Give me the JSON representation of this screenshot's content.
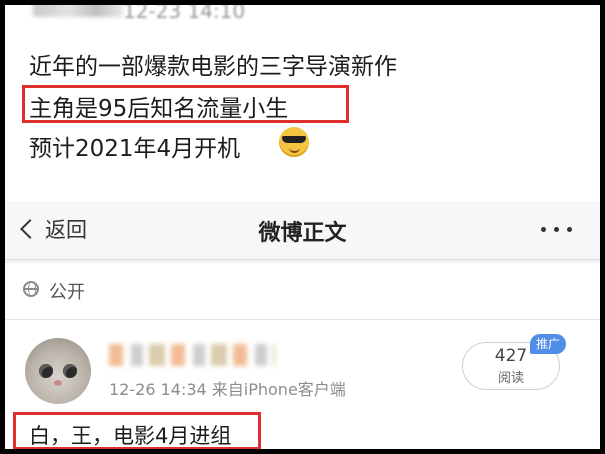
{
  "top_post": {
    "timestamp": "12-23 14:10",
    "lines": [
      "近年的一部爆款电影的三字导演新作",
      "主角是95后知名流量小生",
      "预计2021年4月开机"
    ],
    "emoji_icon": "sunglasses-emoji-icon"
  },
  "nav": {
    "back_label": "返回",
    "title": "微博正文"
  },
  "visibility": {
    "label": "公开",
    "icon": "globe-icon"
  },
  "post": {
    "meta": "12-26 14:34  来自iPhone客户端",
    "read_count": "427",
    "read_label": "阅读",
    "promo_badge": "推广",
    "content": "白，王，电影4月进组"
  },
  "colors": {
    "highlight": "#e02e2e",
    "promo": "#4f8de6",
    "nav_bg": "#f7f7f7"
  }
}
